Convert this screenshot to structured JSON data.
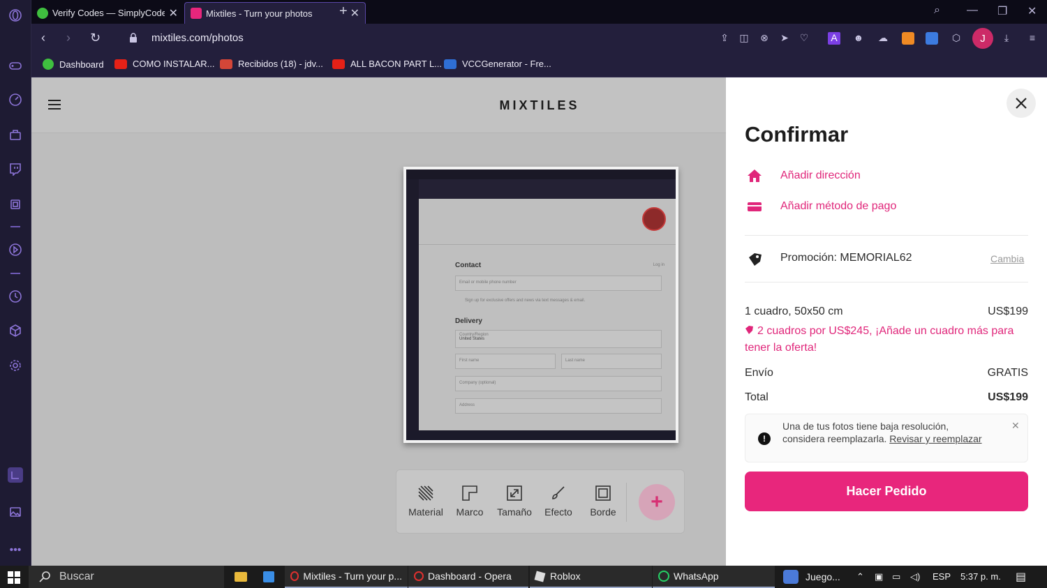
{
  "browser": {
    "tabs": [
      {
        "title": "Verify Codes — SimplyCode",
        "active": false
      },
      {
        "title": "Mixtiles - Turn your photos",
        "active": true
      }
    ],
    "url": "mixtiles.com/photos",
    "avatar_letter": "J",
    "bookmarks": [
      {
        "label": "Dashboard",
        "icon": "simplycodes-icon",
        "color": "#3fbf3f"
      },
      {
        "label": "COMO INSTALAR...",
        "icon": "youtube-icon",
        "color": "#e62117"
      },
      {
        "label": "Recibidos (18) - jdv...",
        "icon": "gmail-icon",
        "color": "#d44638"
      },
      {
        "label": "ALL BACON PART L...",
        "icon": "youtube-icon",
        "color": "#e62117"
      },
      {
        "label": "VCCGenerator - Fre...",
        "icon": "vcc-icon",
        "color": "#2f6fd6"
      }
    ]
  },
  "site": {
    "brand": "MIXTILES",
    "tools": [
      {
        "label": "Material",
        "icon": "material-icon"
      },
      {
        "label": "Marco",
        "icon": "frame-icon"
      },
      {
        "label": "Tamaño",
        "icon": "resize-icon"
      },
      {
        "label": "Efecto",
        "icon": "brush-icon"
      },
      {
        "label": "Borde",
        "icon": "border-icon"
      }
    ],
    "add_symbol": "+",
    "screenshot": {
      "contact": "Contact",
      "login": "Log in",
      "email_placeholder": "Email or mobile phone number",
      "signup": "Sign up for exclusive offers and news via text messages & email.",
      "delivery": "Delivery",
      "country_label": "Country/Region",
      "country_value": "United States",
      "first_name": "First name",
      "last_name": "Last name",
      "company": "Company (optional)",
      "address": "Address"
    }
  },
  "checkout": {
    "title": "Confirmar",
    "add_address": "Añadir dirección",
    "add_payment": "Añadir método de pago",
    "promo": "Promoción: MEMORIAL62",
    "promo_change": "Cambia",
    "item_label": "1 cuadro, 50x50 cm",
    "item_price": "US$199",
    "offer": "2 cuadros por US$245, ¡Añade un cuadro más para tener la oferta!",
    "shipping_label": "Envío",
    "shipping_value": "GRATIS",
    "total_label": "Total",
    "total_value": "US$199",
    "notice_text": "Una de tus fotos tiene baja resolución, considera reemplazarla.",
    "notice_link": "Revisar y reemplazar",
    "order_button": "Hacer Pedido",
    "accent": "#e8267c"
  },
  "taskbar": {
    "search_placeholder": "Buscar",
    "apps": [
      {
        "label": "Mixtiles - Turn your p..."
      },
      {
        "label": "Dashboard - Opera"
      },
      {
        "label": "Roblox"
      },
      {
        "label": "WhatsApp"
      },
      {
        "label": "Juego..."
      }
    ],
    "language": "ESP",
    "time": "5:37 p. m."
  }
}
